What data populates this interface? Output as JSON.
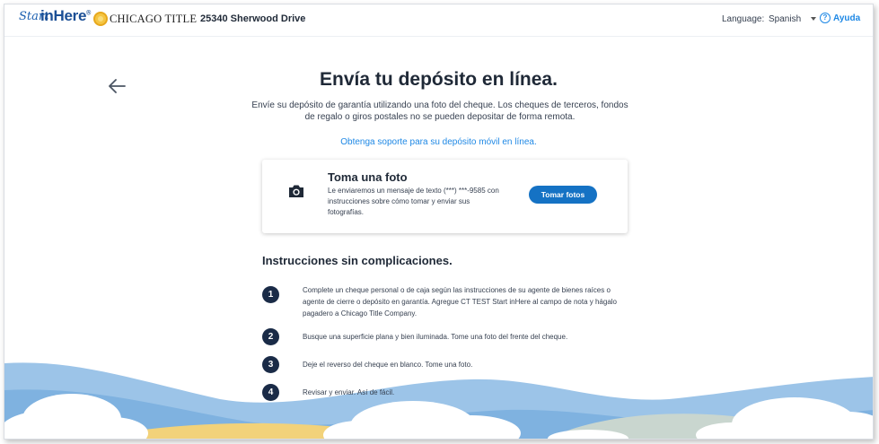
{
  "header": {
    "logo_start": "Start",
    "logo_inhere": "inHere",
    "logo_reg": "®",
    "brand": "CHICAGO TITLE",
    "address": "25340 Sherwood Drive",
    "language_label": "Language:",
    "language_value": "Spanish",
    "help_label": "Ayuda",
    "help_icon_glyph": "?"
  },
  "main": {
    "title": "Envía tu depósito en línea.",
    "intro": "Envíe su depósito de garantía utilizando una foto del cheque. Los cheques de terceros, fondos de regalo o giros postales no se pueden depositar de forma remota.",
    "support_link": "Obtenga soporte para su depósito móvil en línea."
  },
  "card": {
    "icon": "camera-icon",
    "title": "Toma una foto",
    "text": "Le enviaremos un mensaje de texto (***) ***-9585 con instrucciones sobre cómo tomar y enviar sus fotografías.",
    "button": "Tomar fotos"
  },
  "instructions": {
    "title": "Instrucciones sin complicaciones.",
    "steps": [
      {
        "num": "1",
        "text": "Complete un cheque personal o de caja según las instrucciones de su agente de bienes raíces o agente de cierre o depósito en garantía. Agregue CT TEST Start inHere al campo de nota y hágalo pagadero a Chicago Title Company."
      },
      {
        "num": "2",
        "text": "Busque una superficie plana y bien iluminada. Tome una foto del frente del cheque."
      },
      {
        "num": "3",
        "text": "Deje el reverso del cheque en blanco. Tome una foto."
      },
      {
        "num": "4",
        "text": "Revisar y enviar. Así de fácil."
      }
    ]
  },
  "colors": {
    "accent": "#1e88e5",
    "button": "#1572c4",
    "step_badge": "#1a2b47",
    "sky_blue": "#8fbde6",
    "sand": "#f2d27a"
  }
}
